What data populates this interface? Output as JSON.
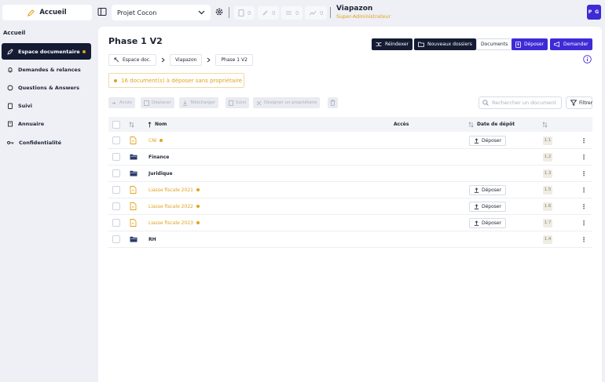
{
  "header": {
    "accueil_label": "Accueil",
    "project": "Projet Cocon",
    "counters": [
      "0",
      "0",
      "0",
      "0"
    ],
    "company": "Viapazon",
    "role": "Super-Administrateur",
    "avatar_initials": "P G"
  },
  "sidebar": {
    "title": "Accueil",
    "items": [
      {
        "label": "Espace documentaire",
        "icon": "rocket-icon"
      },
      {
        "label": "Demandes & relances",
        "icon": "bell-icon"
      },
      {
        "label": "Questions & Answers",
        "icon": "chat-icon"
      },
      {
        "label": "Suivi",
        "icon": "clipboard-icon"
      },
      {
        "label": "Annuaire",
        "icon": "book-icon"
      },
      {
        "label": "Confidentialité",
        "icon": "key-icon"
      }
    ]
  },
  "main": {
    "title": "Phase 1 V2",
    "actions": {
      "reindex": "Réindexer",
      "new_folders": "Nouveaux dossiers",
      "documents": "Documents",
      "deposit": "Déposer",
      "request": "Demander"
    },
    "breadcrumb": [
      "Espace doc.",
      "Viapazon",
      "Phase 1 V2"
    ],
    "alert": "16 document(s) à déposer sans propriétaire",
    "toolbar": {
      "access": "Accès",
      "move": "Déplacer",
      "download": "Télécharger",
      "follow": "Suivi",
      "assign_owner": "Désigner un propriétaire"
    },
    "search_placeholder": "Rechercher un document",
    "filter_label": "Filtrer",
    "columns": {
      "name": "Nom",
      "access": "Accès",
      "date": "Date de dépôt"
    },
    "deposit_label": "Déposer",
    "rows": [
      {
        "name": "CNI",
        "type": "file",
        "pending": true,
        "code": "1.1"
      },
      {
        "name": "Finance",
        "type": "folder",
        "pending": false,
        "code": "1.2"
      },
      {
        "name": "Juridique",
        "type": "folder",
        "pending": false,
        "code": "1.3"
      },
      {
        "name": "Liasse fiscale 2021",
        "type": "file",
        "pending": true,
        "code": "1.5"
      },
      {
        "name": "Liasse fiscale 2022",
        "type": "file",
        "pending": true,
        "code": "1.6"
      },
      {
        "name": "Liasse fiscale 2023",
        "type": "file",
        "pending": true,
        "code": "1.7"
      },
      {
        "name": "RH",
        "type": "folder",
        "pending": false,
        "code": "1.4"
      }
    ]
  }
}
